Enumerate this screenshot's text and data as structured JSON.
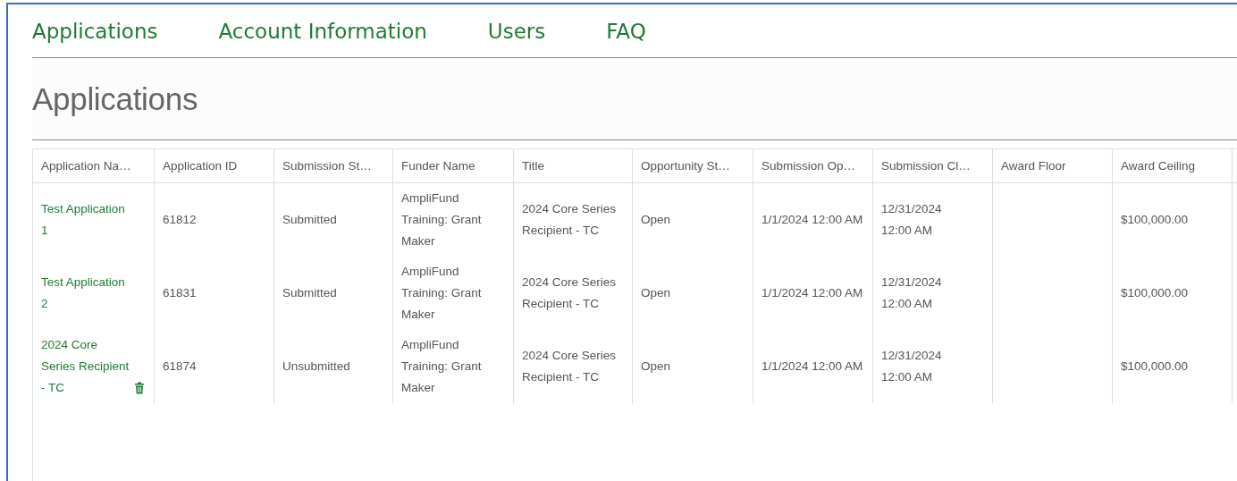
{
  "nav": [
    {
      "label": "Applications"
    },
    {
      "label": "Account Information"
    },
    {
      "label": "Users"
    },
    {
      "label": "FAQ"
    }
  ],
  "heading": "Applications",
  "table": {
    "columns": [
      "Application Na…",
      "Application ID",
      "Submission St…",
      "Funder Name",
      "Title",
      "Opportunity St…",
      "Submission Op…",
      "Submission Cl…",
      "Award Floor",
      "Award Ceiling"
    ],
    "rows": [
      {
        "deletable": false,
        "cells": [
          "Test Application 1",
          "61812",
          "Submitted",
          "AmpliFund Training: Grant Maker",
          "2024 Core Series Recipient - TC",
          "Open",
          "1/1/2024 12:00 AM",
          "12/31/2024 12:00 AM",
          "",
          "$100,000.00"
        ]
      },
      {
        "deletable": false,
        "cells": [
          "Test Application 2",
          "61831",
          "Submitted",
          "AmpliFund Training: Grant Maker",
          "2024 Core Series Recipient - TC",
          "Open",
          "1/1/2024 12:00 AM",
          "12/31/2024 12:00 AM",
          "",
          "$100,000.00"
        ]
      },
      {
        "deletable": true,
        "cells": [
          "2024 Core Series Recipient - TC",
          "61874",
          "Unsubmitted",
          "AmpliFund Training: Grant Maker",
          "2024 Core Series Recipient - TC",
          "Open",
          "1/1/2024 12:00 AM",
          "12/31/2024 12:00 AM",
          "",
          "$100,000.00"
        ]
      }
    ]
  }
}
